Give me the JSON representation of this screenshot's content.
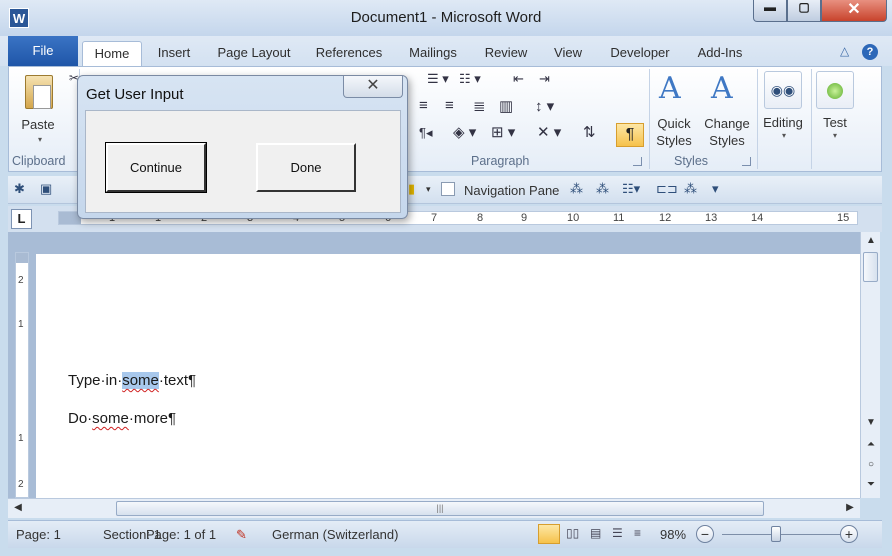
{
  "window": {
    "title": "Document1  -  Microsoft Word",
    "app_icon_letter": "W",
    "controls": {
      "minimize": "▬",
      "maximize": "▢",
      "close": "✕"
    }
  },
  "tabs": [
    {
      "label": "File"
    },
    {
      "label": "Home"
    },
    {
      "label": "Insert"
    },
    {
      "label": "Page Layout"
    },
    {
      "label": "References"
    },
    {
      "label": "Mailings"
    },
    {
      "label": "Review"
    },
    {
      "label": "View"
    },
    {
      "label": "Developer"
    },
    {
      "label": "Add-Ins"
    }
  ],
  "ribbon": {
    "clipboard": {
      "paste_label": "Paste",
      "group_label": "Clipboard"
    },
    "paragraph": {
      "group_label": "Paragraph",
      "show_marks_symbol": "¶"
    },
    "styles": {
      "quick_styles": "Quick Styles",
      "change_styles": "Change Styles",
      "group_label": "Styles"
    },
    "editing": {
      "label": "Editing"
    },
    "test": {
      "label": "Test"
    }
  },
  "qat": {
    "navigation_pane_label": "Navigation Pane",
    "navigation_pane_checked": false
  },
  "ruler": {
    "tab_selector": "L",
    "numbers": [
      "2",
      "1",
      "1",
      "2",
      "3",
      "4",
      "5",
      "6",
      "7",
      "8",
      "9",
      "10",
      "11",
      "12",
      "13",
      "14",
      "15",
      "16"
    ],
    "vertical_numbers": [
      "2",
      "1",
      "1",
      "2"
    ]
  },
  "document": {
    "line1": {
      "before": "Type·in·",
      "highlighted": "some",
      "after": "·text¶",
      "squiggle_word": "some"
    },
    "line2": {
      "before": "Do·",
      "squiggle": "some",
      "after": "·more¶"
    }
  },
  "status": {
    "page": "Page: 1",
    "section": "Section: 1",
    "pages": "Page: 1 of 1",
    "language": "German (Switzerland)",
    "zoom": "98%",
    "zoom_minus": "−",
    "zoom_plus": "+"
  },
  "dialog": {
    "title": "Get User Input",
    "close": "✕",
    "continue_label": "Continue",
    "done_label": "Done"
  },
  "colors": {
    "accent": "#2b5797",
    "highlight": "#a8c8ec",
    "active_button": "#f6c24c",
    "spelling_error": "#d02020"
  }
}
